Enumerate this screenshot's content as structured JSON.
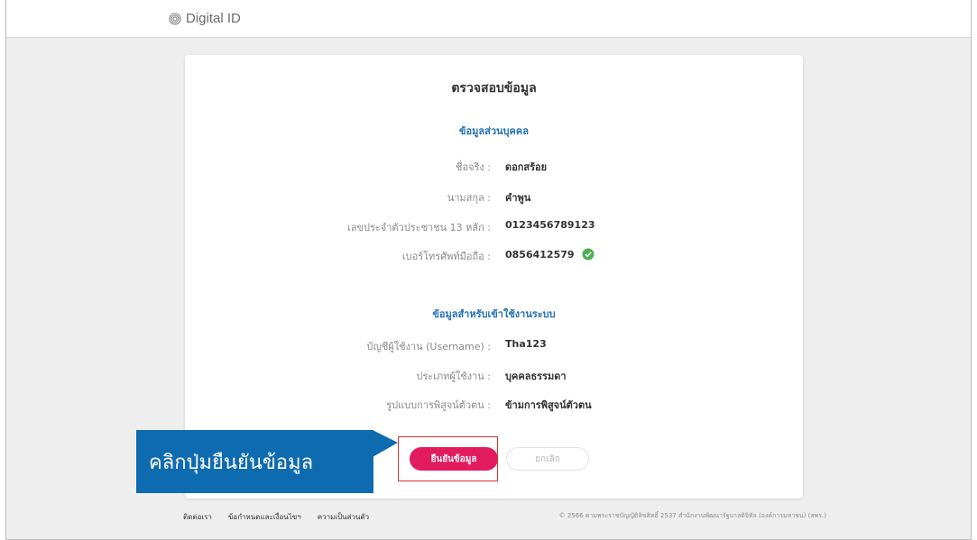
{
  "header": {
    "brand": "Digital ID"
  },
  "card": {
    "title": "ตรวจสอบข้อมูล",
    "personal_section": "ข้อมูลส่วนบุคคล",
    "personal": [
      {
        "label": "ชื่อจริง :",
        "value": "ดอกสร้อย"
      },
      {
        "label": "นามสกุล :",
        "value": "คำพูน"
      },
      {
        "label": "เลขประจำตัวประชาชน 13 หลัก :",
        "value": "0123456789123"
      },
      {
        "label": "เบอร์โทรศัพท์มือถือ :",
        "value": "0856412579"
      }
    ],
    "login_section": "ข้อมูลสำหรับเข้าใช้งานระบบ",
    "login": [
      {
        "label": "บัญชีผู้ใช้งาน (Username) :",
        "value": "Tha123"
      },
      {
        "label": "ประเภทผู้ใช้งาน :",
        "value": "บุคคลธรรมดา"
      },
      {
        "label": "รูปแบบการพิสูจน์ตัวตน :",
        "value": "ข้ามการพิสูจน์ตัวตน"
      }
    ],
    "confirm_label": "ยืนยันข้อมูล",
    "cancel_label": "ยกเลิก"
  },
  "callout": {
    "text": "คลิกปุ่มยืนยันข้อมูล"
  },
  "footer": {
    "links": [
      "ติดต่อเรา",
      "ข้อกำหนดและเงื่อนไขฯ",
      "ความเป็นส่วนตัว"
    ],
    "copyright": "© 2566 ตามพระราชบัญญัติลิขสิทธิ์ 2537 สำนักงานพัฒนารัฐบาลดิจิทัล (องค์การมหาชน) (สพร.)"
  },
  "colors": {
    "accent": "#e21a5e",
    "section": "#2471b5",
    "callout": "#0f6bb0",
    "verified": "#4caf50"
  }
}
